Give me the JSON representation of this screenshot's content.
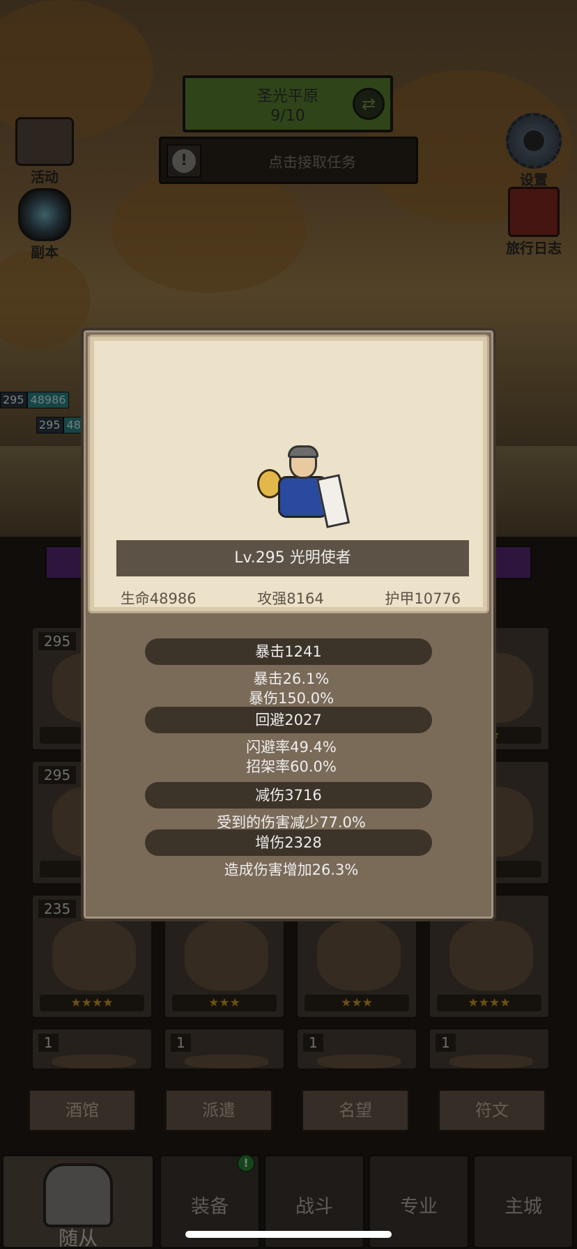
{
  "region": {
    "name": "圣光平原",
    "progress": "9/10"
  },
  "quest": {
    "text": "点击接取任务"
  },
  "side_buttons": {
    "activity": "活动",
    "dungeon": "副本",
    "settings": "设置",
    "journal": "旅行日志"
  },
  "hp_tags": [
    {
      "level": "295",
      "value": "48986"
    },
    {
      "level": "295",
      "value": "48"
    }
  ],
  "units": [
    {
      "level": "295",
      "stars": "★"
    },
    {
      "level": "",
      "stars": "★"
    },
    {
      "level": "",
      "stars": "★"
    },
    {
      "level": "",
      "stars": "★★"
    },
    {
      "level": "295",
      "stars": "★"
    },
    {
      "level": "",
      "stars": ""
    },
    {
      "level": "",
      "stars": ""
    },
    {
      "level": "",
      "stars": "★"
    },
    {
      "level": "235",
      "stars": "★★★★"
    },
    {
      "level": "",
      "stars": "★★★"
    },
    {
      "level": "",
      "stars": "★★★"
    },
    {
      "level": "",
      "stars": "★★★★"
    },
    {
      "level": "1",
      "stars": ""
    },
    {
      "level": "1",
      "stars": ""
    },
    {
      "level": "1",
      "stars": ""
    },
    {
      "level": "1",
      "stars": ""
    }
  ],
  "sub_tabs": [
    "酒馆",
    "派遣",
    "名望",
    "符文"
  ],
  "main_tabs": {
    "follower": "随从",
    "equipment": "装备",
    "battle": "战斗",
    "profession": "专业",
    "main_city": "主城"
  },
  "tab_badge": "!",
  "modal": {
    "title": "Lv.295 光明使者",
    "stats": {
      "hp": "生命48986",
      "attack": "攻强8164",
      "armor": "护甲10776"
    },
    "crit": {
      "label": "暴击1241",
      "rate": "暴击26.1%",
      "damage": "暴伤150.0%"
    },
    "dodge": {
      "label": "回避2027",
      "rate": "闪避率49.4%",
      "parry": "招架率60.0%"
    },
    "reduce": {
      "label": "减伤3716",
      "desc": "受到的伤害减少77.0%"
    },
    "boost": {
      "label": "增伤2328",
      "desc": "造成伤害增加26.3%"
    }
  }
}
